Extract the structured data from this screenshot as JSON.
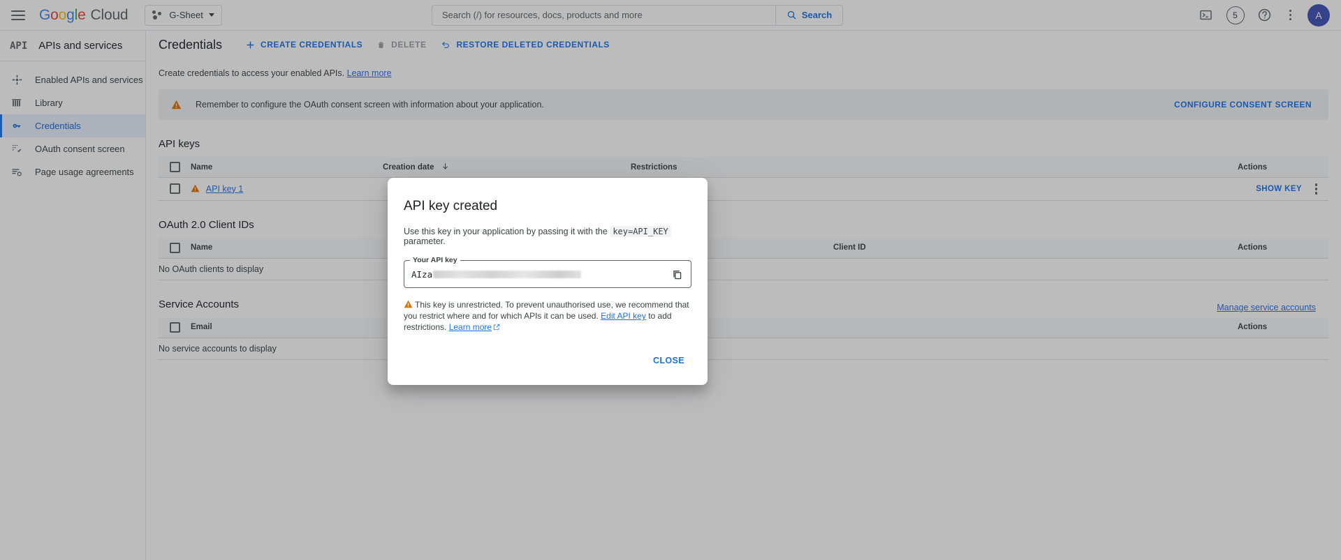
{
  "topbar": {
    "menu_icon": "hamburger-icon",
    "logo": {
      "google": "Google",
      "cloud": "Cloud"
    },
    "project_chip": {
      "label": "G-Sheet",
      "icon": "project-dots-icon",
      "caret": "chevron-down-icon"
    },
    "search": {
      "placeholder": "Search (/) for resources, docs, products and more",
      "value": "",
      "button_label": "Search",
      "button_icon": "search-icon"
    },
    "right_icons": {
      "cloud_shell": "terminal-icon",
      "notifications_count": "5",
      "help": "help-icon",
      "more": "kebab-menu-icon",
      "avatar_initial": "A"
    }
  },
  "sidebar": {
    "product_glyph": "API",
    "product_title": "APIs and services",
    "items": [
      {
        "label": "Enabled APIs and services",
        "icon": "enabled-apis-icon",
        "active": false
      },
      {
        "label": "Library",
        "icon": "library-icon",
        "active": false
      },
      {
        "label": "Credentials",
        "icon": "key-icon",
        "active": true
      },
      {
        "label": "OAuth consent screen",
        "icon": "consent-screen-icon",
        "active": false
      },
      {
        "label": "Page usage agreements",
        "icon": "usage-agreements-icon",
        "active": false
      }
    ]
  },
  "page": {
    "title": "Credentials",
    "toolbar": [
      {
        "label": "CREATE CREDENTIALS",
        "icon": "plus-icon",
        "disabled": false
      },
      {
        "label": "DELETE",
        "icon": "trash-icon",
        "disabled": true
      },
      {
        "label": "RESTORE DELETED CREDENTIALS",
        "icon": "restore-icon",
        "disabled": false
      }
    ],
    "lead_text": "Create credentials to access your enabled APIs.",
    "lead_link": "Learn more",
    "banner": {
      "icon": "warning-triangle-icon",
      "text": "Remember to configure the OAuth consent screen with information about your application.",
      "button_label": "CONFIGURE CONSENT SCREEN"
    },
    "api_keys": {
      "title": "API keys",
      "columns": [
        "Name",
        "Creation date",
        "Restrictions",
        "Actions"
      ],
      "sort_column": "Creation date",
      "sort_icon": "arrow-down-icon",
      "rows": [
        {
          "name": "API key 1",
          "name_icon": "warning-triangle-icon",
          "creation_date": "",
          "restrictions": "",
          "action_label": "SHOW KEY",
          "action_menu": "kebab-menu-icon"
        }
      ]
    },
    "oauth_clients": {
      "title": "OAuth 2.0 Client IDs",
      "columns": [
        "Name",
        "Client ID",
        "Actions"
      ],
      "empty_text": "No OAuth clients to display"
    },
    "service_accounts": {
      "title": "Service Accounts",
      "manage_link": "Manage service accounts",
      "columns": [
        "Email",
        "Actions"
      ],
      "empty_text": "No service accounts to display"
    }
  },
  "modal": {
    "title": "API key created",
    "desc_before": "Use this key in your application by passing it with the",
    "desc_code": "key=API_KEY",
    "desc_after": "parameter.",
    "field_label": "Your API key",
    "field_value_prefix": "AIza",
    "field_value_redacted": true,
    "copy_icon": "copy-icon",
    "warning_icon": "warning-triangle-icon",
    "warning_text_1": "This key is unrestricted. To prevent unauthorised use, we recommend that you restrict where and for which APIs it can be used.",
    "warning_link_edit": "Edit API key",
    "warning_text_2": "to add restrictions.",
    "warning_link_more": "Learn more",
    "external_icon": "external-link-icon",
    "close_label": "CLOSE"
  },
  "colors": {
    "brand_blue": "#1a73e8",
    "warning_orange": "#e37400",
    "active_bg": "#e8f0fe",
    "avatar": "#3f51b5"
  }
}
